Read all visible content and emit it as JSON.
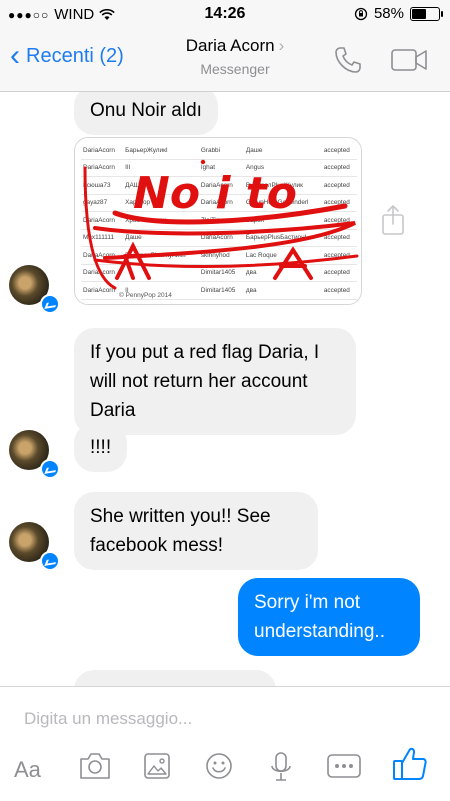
{
  "status_bar": {
    "carrier": "WIND",
    "time": "14:26",
    "battery": "58%",
    "battery_level": 0.58
  },
  "header": {
    "back_label": "Recenti (2)",
    "contact_name": "Daria Acorn",
    "subtitle": "Messenger"
  },
  "messages": {
    "m1": "Onu Noir aldı",
    "m2": "If you put a red flag Daria, I will not return her account Daria",
    "m3": "!!!!",
    "m4": "She written you!! See facebook mess!",
    "m5": "Sorry i'm not understanding.."
  },
  "shared_image": {
    "rows": [
      [
        "DariaAcorn",
        "БарьерЖуликI",
        "Grabbi",
        "Даше",
        "accepted"
      ],
      [
        "DariaAcorn",
        "III",
        "Ighat",
        "Angus",
        "accepted"
      ],
      [
        "Ксюша73",
        "ДАША",
        "DariaAcorn",
        "ВыстрелPlusЖулик",
        "accepted"
      ],
      [
        "gayaz87",
        "Хардкор",
        "DariaAcorn",
        "GroupHeroGoHenderl",
        "accepted"
      ],
      [
        "DariaAcorn",
        "ХрабЧемпион",
        "ZloiTip",
        "Барья",
        "accepted"
      ],
      [
        "Max111111",
        "Даше",
        "DariaAcorn",
        "БарьерPlusБастионI",
        "accepted"
      ],
      [
        "DariaAcorn",
        "ВыстрелPlusЖуликII",
        "skinnyhod",
        "Lac Roque",
        "accepted"
      ],
      [
        "DariaAcorn",
        "",
        "Dimitar1405",
        "два",
        "accepted"
      ],
      [
        "DariaAcorn",
        "II",
        "Dimitar1405",
        "два",
        "accepted"
      ]
    ],
    "caption": "© PennyPop 2014",
    "scribble_text": "No i to"
  },
  "composer": {
    "placeholder": "Digita un messaggio...",
    "aa_label": "Aa"
  },
  "colors": {
    "accent": "#0084ff",
    "ios_blue": "#1e7cf2",
    "incoming_bubble": "#f1f0f0",
    "scribble_red": "#e01010"
  }
}
